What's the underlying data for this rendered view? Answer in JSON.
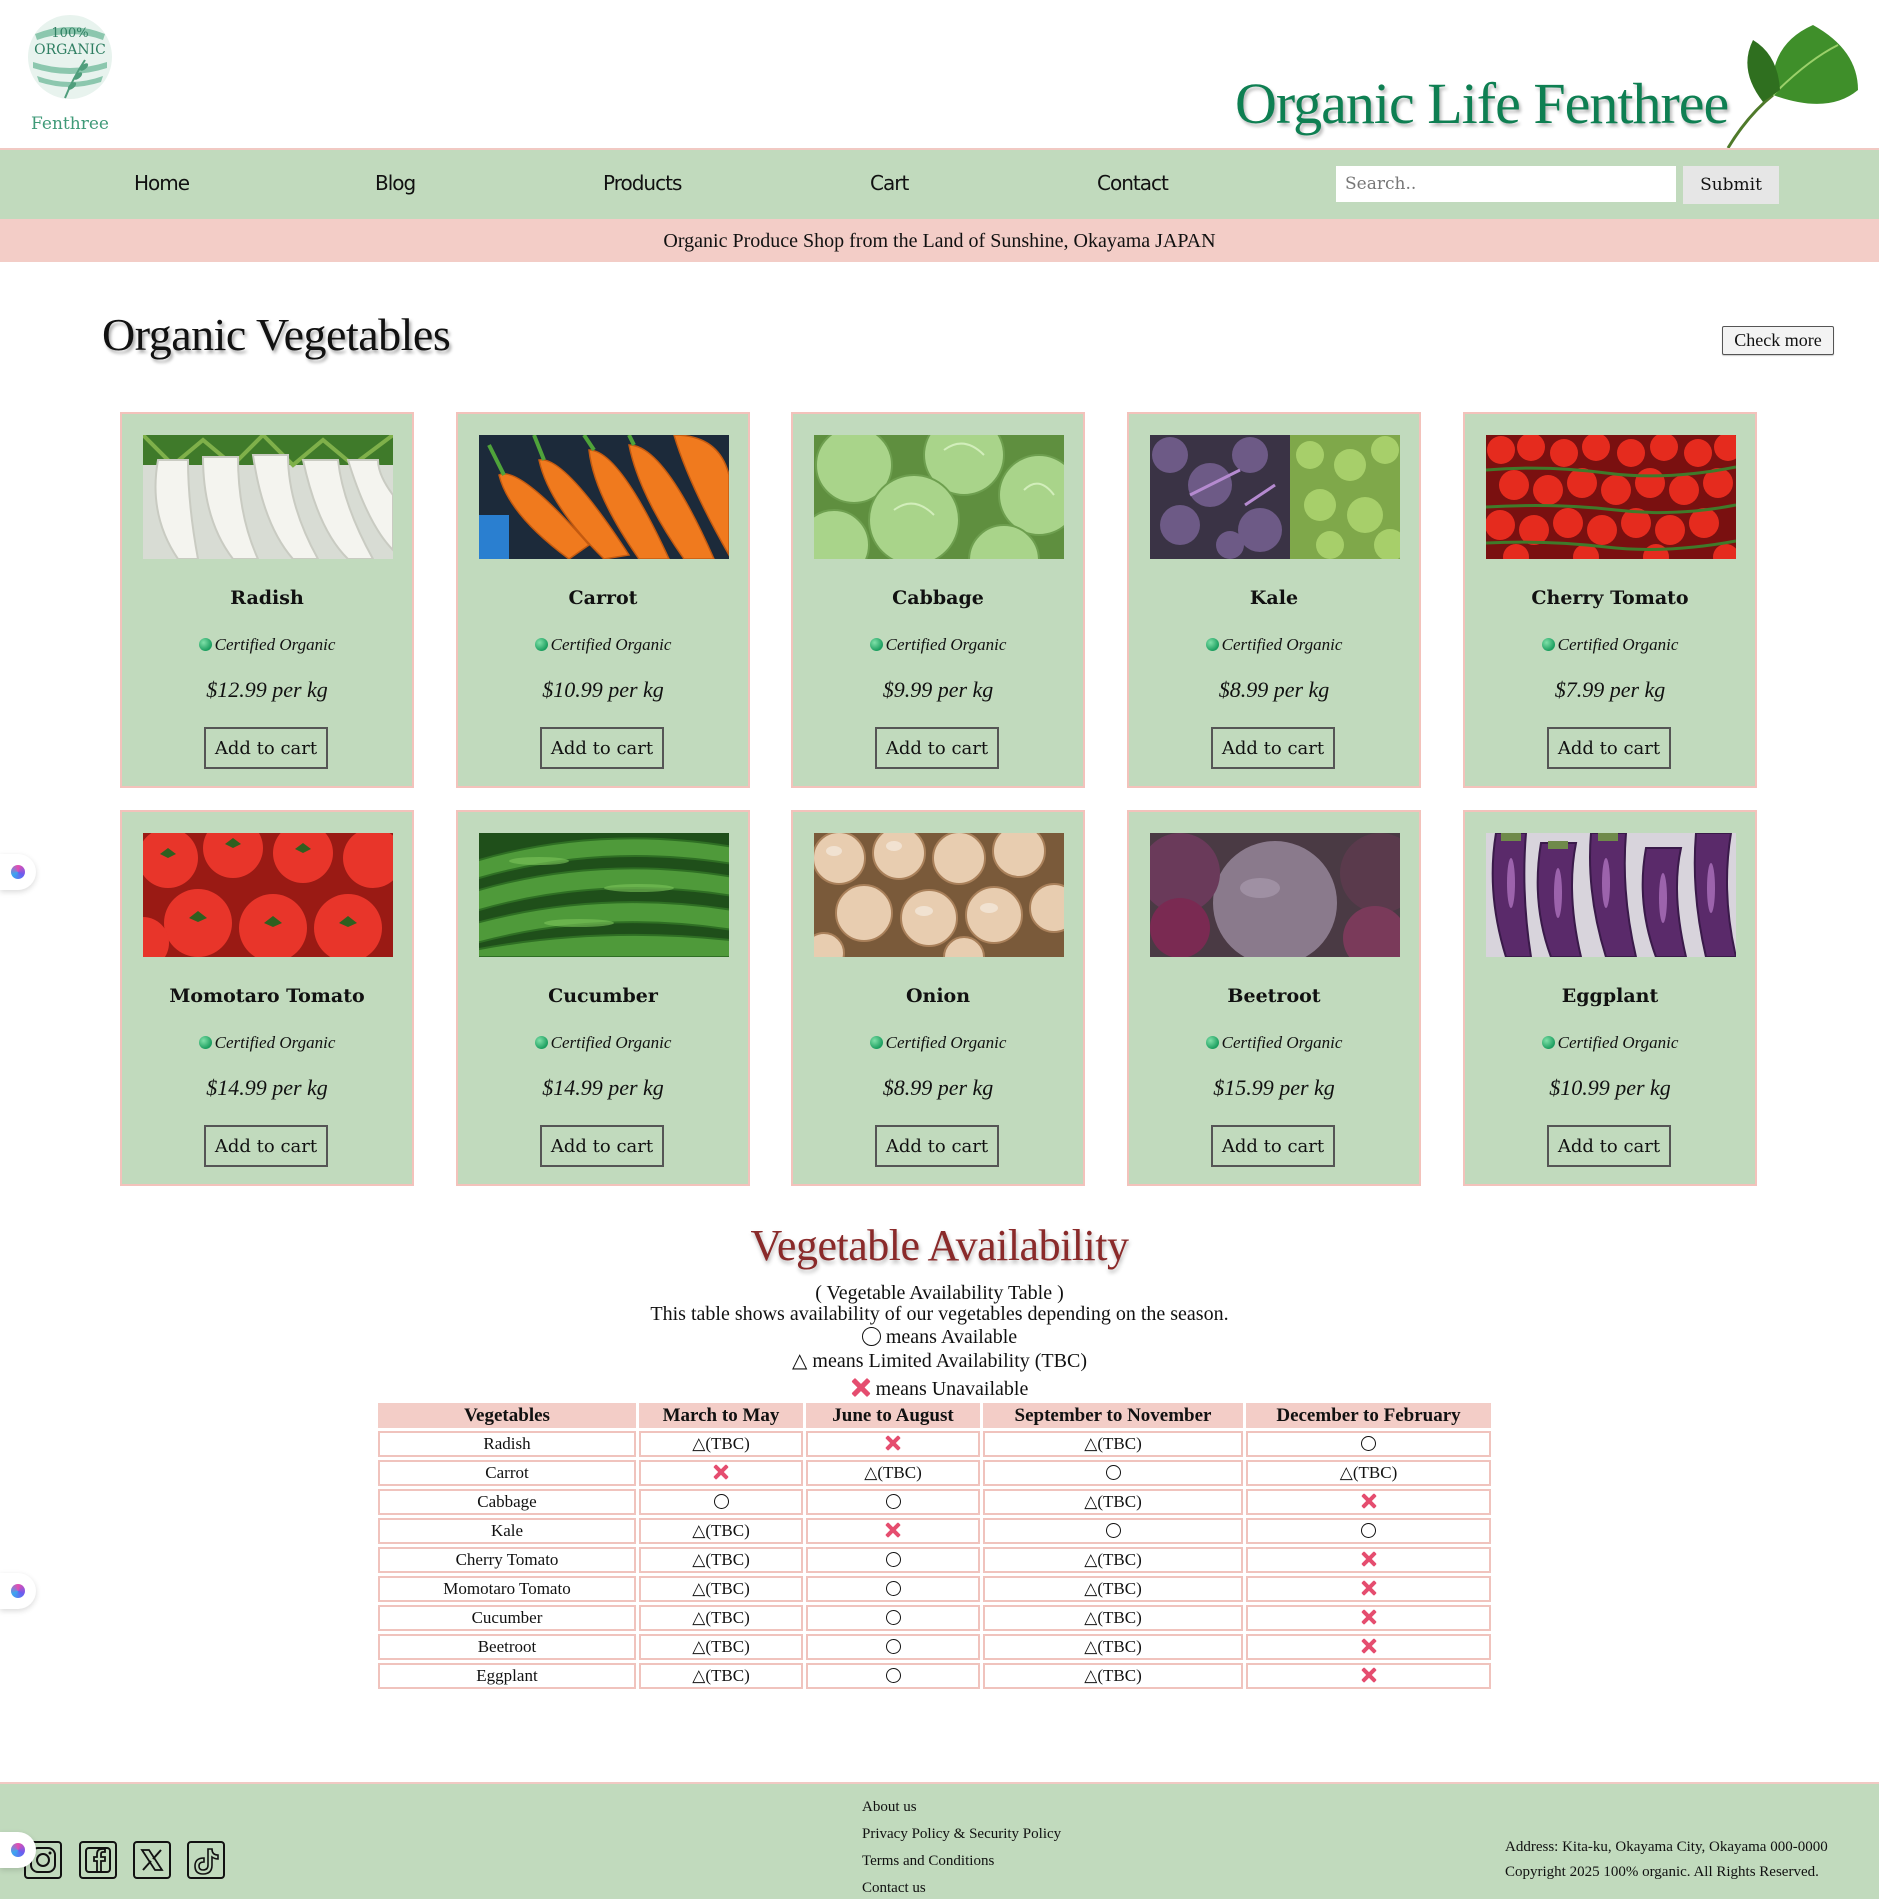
{
  "header": {
    "logo_top": "100%",
    "logo_main": "ORGANIC",
    "logo_sub": "Fenthree",
    "site_title": "Organic Life Fenthree"
  },
  "nav": {
    "items": [
      "Home",
      "Blog",
      "Products",
      "Cart",
      "Contact"
    ],
    "search_placeholder": "Search..",
    "submit_label": "Submit"
  },
  "tagline": "Organic Produce Shop from the Land of Sunshine, Okayama JAPAN",
  "products_section": {
    "title": "Organic Vegetables",
    "check_more_label": "Check more",
    "cert_label": "Certified Organic",
    "add_to_cart_label": "Add to cart",
    "products": [
      {
        "name": "Radish",
        "price": "$12.99 per kg"
      },
      {
        "name": "Carrot",
        "price": "$10.99 per kg"
      },
      {
        "name": "Cabbage",
        "price": "$9.99 per kg"
      },
      {
        "name": "Kale",
        "price": "$8.99 per kg"
      },
      {
        "name": "Cherry Tomato",
        "price": "$7.99 per kg"
      },
      {
        "name": "Momotaro Tomato",
        "price": "$14.99 per kg"
      },
      {
        "name": "Cucumber",
        "price": "$14.99 per kg"
      },
      {
        "name": "Onion",
        "price": "$8.99 per kg"
      },
      {
        "name": "Beetroot",
        "price": "$15.99 per kg"
      },
      {
        "name": "Eggplant",
        "price": "$10.99 per kg"
      }
    ]
  },
  "availability": {
    "title": "Vegetable Availability",
    "caption": "( Vegetable Availability Table )",
    "description": "This table shows availability of our vegetables depending on the season.",
    "legend_available": "means Available",
    "legend_limited": "△ means Limited Availability (TBC)",
    "legend_unavailable": "means Unavailable",
    "limited_text": "△(TBC)",
    "headers": [
      "Vegetables",
      "March to May",
      "June to August",
      "September to November",
      "December to February"
    ],
    "rows": [
      {
        "name": "Radish",
        "values": [
          "limited",
          "unavailable",
          "limited",
          "available"
        ]
      },
      {
        "name": "Carrot",
        "values": [
          "unavailable",
          "limited",
          "available",
          "limited"
        ]
      },
      {
        "name": "Cabbage",
        "values": [
          "available",
          "available",
          "limited",
          "unavailable"
        ]
      },
      {
        "name": "Kale",
        "values": [
          "limited",
          "unavailable",
          "available",
          "available"
        ]
      },
      {
        "name": "Cherry Tomato",
        "values": [
          "limited",
          "available",
          "limited",
          "unavailable"
        ]
      },
      {
        "name": "Momotaro Tomato",
        "values": [
          "limited",
          "available",
          "limited",
          "unavailable"
        ]
      },
      {
        "name": "Cucumber",
        "values": [
          "limited",
          "available",
          "limited",
          "unavailable"
        ]
      },
      {
        "name": "Beetroot",
        "values": [
          "limited",
          "available",
          "limited",
          "unavailable"
        ]
      },
      {
        "name": "Eggplant",
        "values": [
          "limited",
          "available",
          "limited",
          "unavailable"
        ]
      }
    ]
  },
  "footer": {
    "social_icons": [
      "instagram-icon",
      "facebook-icon",
      "x-icon",
      "tiktok-icon"
    ],
    "links": [
      "About us",
      "Privacy Policy & Security Policy",
      "Terms and Conditions",
      "Contact us"
    ],
    "address": "Address: Kita-ku, Okayama City, Okayama 000-0000",
    "copyright": "Copyright 2025 100% organic. All Rights Reserved."
  },
  "colors": {
    "brand_green": "#0e7f52",
    "nav_bg": "#c1dabd",
    "accent_pink": "#f3cdc7",
    "availability_title": "#8a2a2a",
    "unavailable_mark": "#e54d6f"
  }
}
